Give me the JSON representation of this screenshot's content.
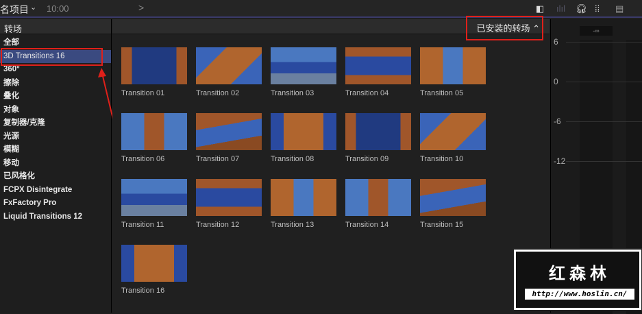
{
  "topbar": {
    "project": "名项目",
    "time": "10:00",
    "forward": ">"
  },
  "sidebar": {
    "title": "转场",
    "items": [
      "全部",
      "3D Transitions 16",
      "360°",
      "擦除",
      "叠化",
      "对象",
      "复制器/克隆",
      "光源",
      "模糊",
      "移动",
      "已风格化",
      "FCPX Disintegrate",
      "FxFactory Pro",
      "Liquid Transitions 12"
    ],
    "selected": 1
  },
  "browser": {
    "sort_label": "已安装的转场",
    "items": [
      "Transition 01",
      "Transition 02",
      "Transition 03",
      "Transition 04",
      "Transition 05",
      "Transition 06",
      "Transition 07",
      "Transition 08",
      "Transition 09",
      "Transition 10",
      "Transition 11",
      "Transition 12",
      "Transition 13",
      "Transition 14",
      "Transition 15",
      "Transition 16"
    ]
  },
  "meters": {
    "peak": "-∞",
    "scale": [
      "6",
      "0",
      "-6",
      "-12"
    ]
  },
  "watermark": {
    "name": "红森林",
    "url": "http://www.hoslin.cn/"
  },
  "colors": {
    "selection": "#3a4a80",
    "annotation": "#e0201a"
  }
}
